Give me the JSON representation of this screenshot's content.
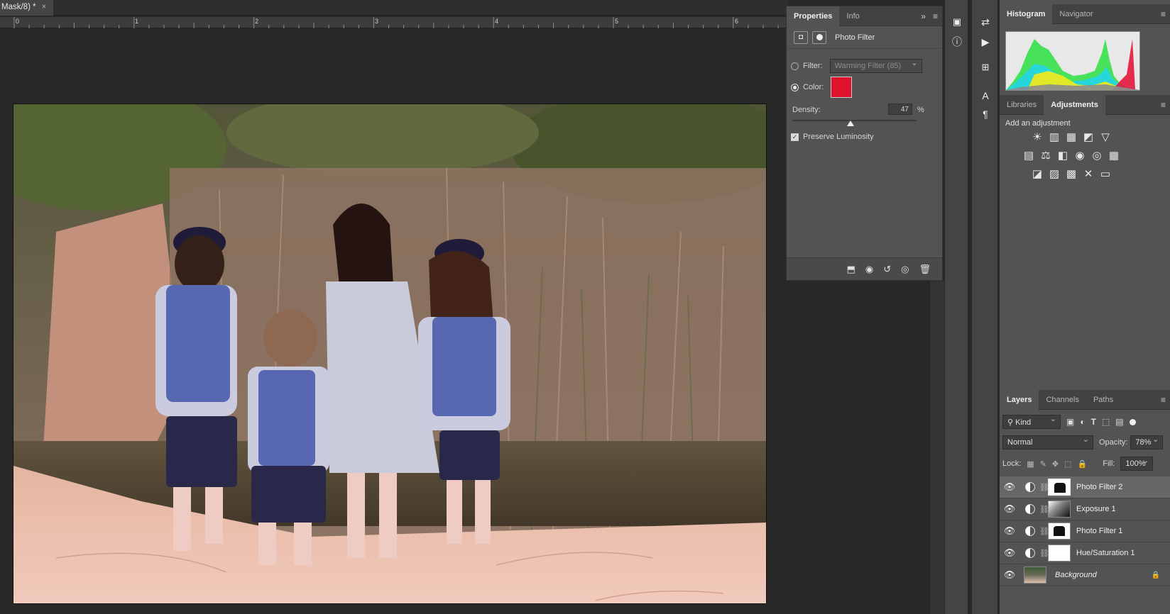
{
  "document": {
    "tab_title": "Mask/8) *",
    "tab_close": "×",
    "ruler_marks": [
      "0",
      "1",
      "2",
      "3",
      "4",
      "5",
      "6"
    ]
  },
  "properties": {
    "tabs": [
      "Properties",
      "Info"
    ],
    "expand_glyph": "»",
    "menu_glyph": "≡",
    "adjustment_name": "Photo Filter",
    "filter_label": "Filter:",
    "filter_value": "Warming Filter (85)",
    "color_label": "Color:",
    "color_swatch": "#e0132f",
    "density_label": "Density:",
    "density_value": "47",
    "density_unit": "%",
    "density_fraction": 0.47,
    "preserve_label": "Preserve Luminosity"
  },
  "top_panels": {
    "tabs": [
      "Histogram",
      "Navigator"
    ]
  },
  "adjustments": {
    "tabs": [
      "Libraries",
      "Adjustments"
    ],
    "add_label": "Add an adjustment",
    "row1": [
      "☀",
      "▥",
      "▦",
      "◩",
      "▽"
    ],
    "row2": [
      "▤",
      "⚖",
      "◧",
      "◉",
      "◎",
      "▦"
    ],
    "row3": [
      "◪",
      "▨",
      "▩",
      "✕",
      "▭"
    ]
  },
  "layers": {
    "tabs": [
      "Layers",
      "Channels",
      "Paths"
    ],
    "kind_label": "Kind",
    "blend_mode": "Normal",
    "opacity_label": "Opacity:",
    "opacity_value": "78%",
    "lock_label": "Lock:",
    "fill_label": "Fill:",
    "fill_value": "100%",
    "items": [
      {
        "name": "Photo Filter 2",
        "selected": true,
        "thumb": "mask-kids"
      },
      {
        "name": "Exposure 1",
        "selected": false,
        "thumb": "mask-gradient"
      },
      {
        "name": "Photo Filter 1",
        "selected": false,
        "thumb": "mask-kids"
      },
      {
        "name": "Hue/Saturation 1",
        "selected": false,
        "thumb": "mask-white"
      },
      {
        "name": "Background",
        "selected": false,
        "thumb": "photo"
      }
    ]
  }
}
